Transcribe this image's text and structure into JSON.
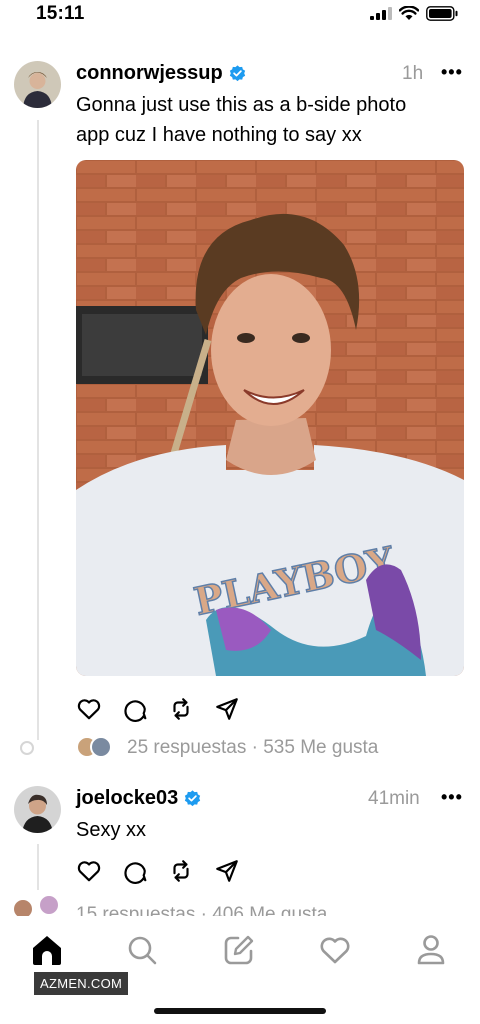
{
  "status_bar": {
    "time": "15:11"
  },
  "post1": {
    "username": "connorwjessup",
    "timestamp": "1h",
    "more": "•••",
    "text_line1": "Gonna just use this as a b-side photo",
    "text_line2": "app cuz I have nothing to say xx",
    "stats": "25 respuestas · 535 Me gusta"
  },
  "reply1": {
    "username": "joelocke03",
    "timestamp": "41min",
    "more": "•••",
    "text": "Sexy xx",
    "stats_partial": "15 respuestas · 406 Me gusta"
  },
  "watermark": "AZMEN.COM",
  "colors": {
    "verified": "#1d9bf0",
    "muted": "#9a9a9a",
    "thread_line": "#e3e3e3"
  },
  "icons": [
    "heart-icon",
    "comment-icon",
    "repost-icon",
    "share-icon",
    "home-icon",
    "search-icon",
    "compose-icon",
    "activity-icon",
    "profile-icon"
  ]
}
